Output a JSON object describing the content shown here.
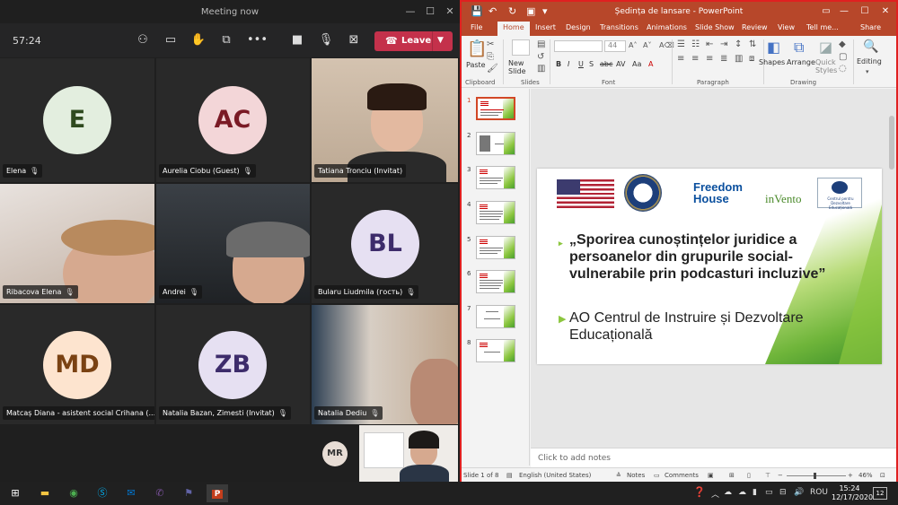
{
  "teams": {
    "title": "Meeting now",
    "timer": "57:24",
    "leave_label": "Leave",
    "mic_glyph": "🎙",
    "participants": [
      {
        "name": "Elena",
        "initials": "E",
        "bg": "#e3eedf",
        "fg": "#2f4a1f"
      },
      {
        "name": "Aurelia Ciobu (Guest)",
        "initials": "AC",
        "bg": "#f3d6d8",
        "fg": "#7a1a25"
      },
      {
        "name": "Tatiana Tronciu (Invitat)"
      },
      {
        "name": "Ribacova Elena"
      },
      {
        "name": "Andrei"
      },
      {
        "name": "Bularu Liudmila (гость)",
        "initials": "BL",
        "bg": "#e6e0f2",
        "fg": "#3d2c6b"
      },
      {
        "name": "Matcaș Diana - asistent social Crihana (...",
        "initials": "MD",
        "bg": "#fde4cf",
        "fg": "#7a4213"
      },
      {
        "name": "Natalia Bazan, Zimesti (Invitat)",
        "initials": "ZB",
        "bg": "#e6e0f2",
        "fg": "#3d2c6b"
      },
      {
        "name": "Natalia Dediu"
      }
    ],
    "self_initials": "MR"
  },
  "ppt": {
    "title": "Ședința de lansare - PowerPoint",
    "tabs": [
      "File",
      "Home",
      "Insert",
      "Design",
      "Transitions",
      "Animations",
      "Slide Show",
      "Review",
      "View",
      "Tell me...",
      "Share"
    ],
    "groups": [
      "Clipboard",
      "Slides",
      "Font",
      "Paragraph",
      "Drawing"
    ],
    "paste_label": "Paste",
    "new_slide_label": "New Slide",
    "font_size": "44",
    "shapes_label": "Shapes",
    "arrange_label": "Arrange",
    "quick_styles_label": "Quick Styles",
    "editing_label": "Editing",
    "slide_numbers": [
      "1",
      "2",
      "3",
      "4",
      "5",
      "6",
      "7",
      "8"
    ],
    "slide": {
      "logo_fh": "Freedom House",
      "logo_invento": "inVento",
      "logo_center": "Centrul pentru Dezvoltare Educațională",
      "bullet1": "„Sporirea cunoștințelor juridice a persoanelor din grupurile social-vulnerabile prin podcasturi incluzive”",
      "bullet2": "AO Centrul de Instruire și Dezvoltare Educațională"
    },
    "notes_placeholder": "Click to add notes",
    "status": {
      "slide_of": "Slide 1 of 8",
      "language": "English (United States)",
      "notes": "Notes",
      "comments": "Comments",
      "zoom": "46%"
    }
  },
  "taskbar": {
    "lang": "ROU",
    "time": "15:24",
    "date": "12/17/2020",
    "notif_count": "12"
  }
}
